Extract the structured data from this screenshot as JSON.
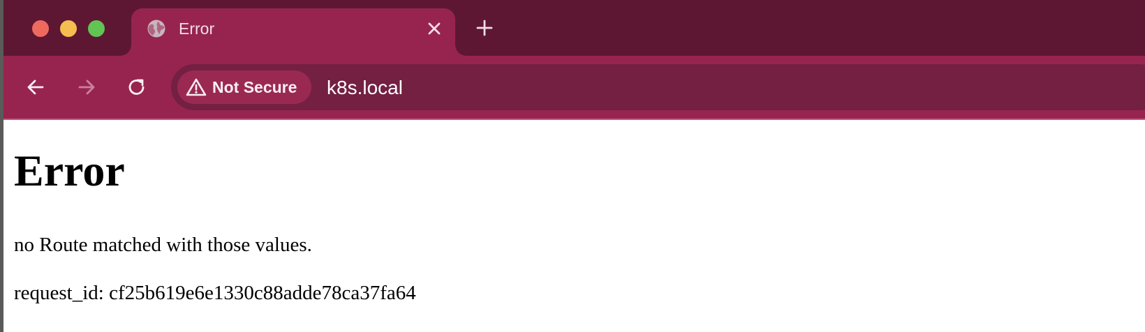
{
  "browser": {
    "tab": {
      "title": "Error",
      "favicon": "globe-icon"
    },
    "toolbar": {
      "security_label": "Not Secure",
      "url": "k8s.local"
    },
    "colors": {
      "frame": "#5d1733",
      "tab_active": "#97244f",
      "omnibox": "#732042",
      "security_chip": "#9a2952"
    }
  },
  "page": {
    "heading": "Error",
    "message": "no Route matched with those values.",
    "request_id": "request_id: cf25b619e6e1330c88adde78ca37fa64"
  }
}
